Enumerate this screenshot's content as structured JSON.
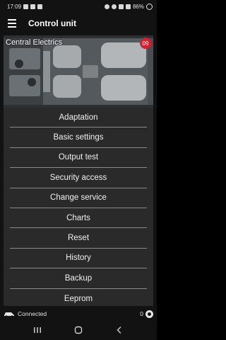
{
  "status_bar": {
    "time": "17:09",
    "battery": "86%"
  },
  "app_bar": {
    "title": "Control unit"
  },
  "unit": {
    "name": "Central Electrics",
    "badge": "09"
  },
  "menu": [
    {
      "label": "Adaptation"
    },
    {
      "label": "Basic settings"
    },
    {
      "label": "Output test"
    },
    {
      "label": "Security access"
    },
    {
      "label": "Change service"
    },
    {
      "label": "Charts"
    },
    {
      "label": "Reset"
    },
    {
      "label": "History"
    },
    {
      "label": "Backup"
    },
    {
      "label": "Eeprom"
    }
  ],
  "footer": {
    "connection": "Connected",
    "count": "0"
  },
  "colors": {
    "accent_red": "#d3202f",
    "panel": "#2a2a2a",
    "background": "#121212"
  }
}
